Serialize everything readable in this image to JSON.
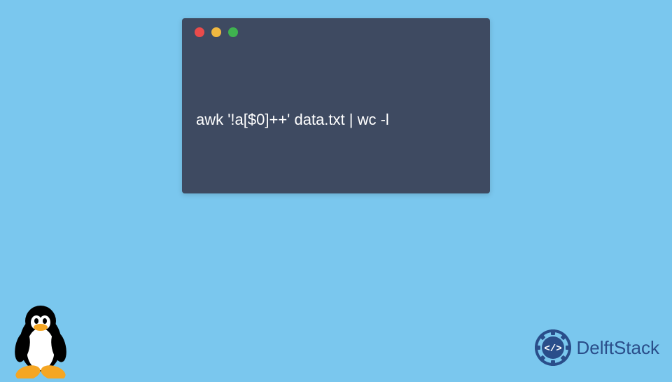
{
  "terminal": {
    "command": "awk '!a[$0]++' data.txt | wc -l",
    "dots": [
      "close",
      "minimize",
      "maximize"
    ]
  },
  "brand": {
    "name": "DelftStack"
  },
  "icons": {
    "tux": "linux-tux",
    "brand_logo": "delftstack-logo"
  }
}
